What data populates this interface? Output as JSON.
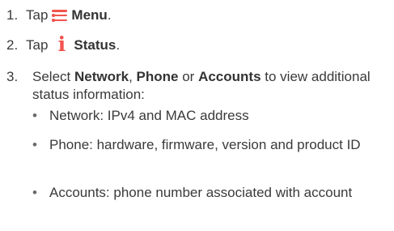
{
  "steps": [
    {
      "number": "1.",
      "prefix": "Tap",
      "icon": "menu-icon",
      "target": "Menu",
      "suffix": "."
    },
    {
      "number": "2.",
      "prefix": "Tap",
      "icon": "info-icon",
      "icon_glyph": "i",
      "target": "Status",
      "suffix": "."
    },
    {
      "number": "3.",
      "prefix": "Select",
      "option1": "Network",
      "sep1": ",",
      "option2": "Phone",
      "sep2": "or",
      "option3": "Accounts",
      "suffix": "to view additional status information:"
    }
  ],
  "bullets": [
    "Network: IPv4 and MAC address",
    "Phone: hardware, firmware, version and product ID",
    "Accounts: phone number associated with account"
  ],
  "bullet_glyph": "•",
  "colors": {
    "text": "#3a3a3a",
    "accent": "#f2544f"
  }
}
